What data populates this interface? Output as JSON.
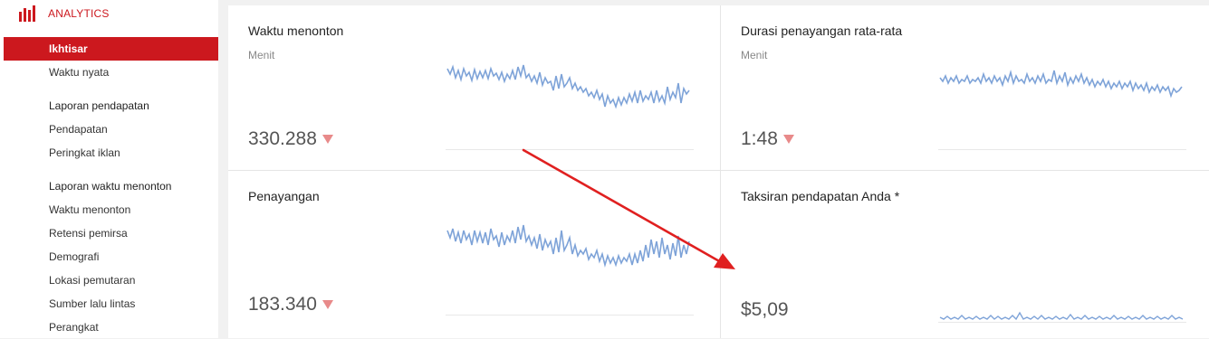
{
  "sidebar": {
    "brand_label": "ANALYTICS",
    "items": [
      {
        "label": "Ikhtisar"
      },
      {
        "label": "Waktu nyata"
      },
      {
        "label": "Laporan pendapatan"
      },
      {
        "label": "Pendapatan"
      },
      {
        "label": "Peringkat iklan"
      },
      {
        "label": "Laporan waktu menonton"
      },
      {
        "label": "Waktu menonton"
      },
      {
        "label": "Retensi pemirsa"
      },
      {
        "label": "Demografi"
      },
      {
        "label": "Lokasi pemutaran"
      },
      {
        "label": "Sumber lalu lintas"
      },
      {
        "label": "Perangkat"
      }
    ]
  },
  "cards": [
    {
      "title": "Waktu menonton",
      "subtitle": "Menit",
      "value": "330.288",
      "trend": "down"
    },
    {
      "title": "Durasi penayangan rata-rata",
      "subtitle": "Menit",
      "value": "1:48",
      "trend": "down"
    },
    {
      "title": "Penayangan",
      "subtitle": "",
      "value": "183.340",
      "trend": "down"
    },
    {
      "title": "Taksiran pendapatan Anda *",
      "subtitle": "",
      "value": "$5,09",
      "trend": "none"
    }
  ],
  "colors": {
    "accent": "#cc181e",
    "sparkline": "#7ea3d8",
    "trend_down": "#e88a8a",
    "annotation_arrow": "#e02020"
  }
}
